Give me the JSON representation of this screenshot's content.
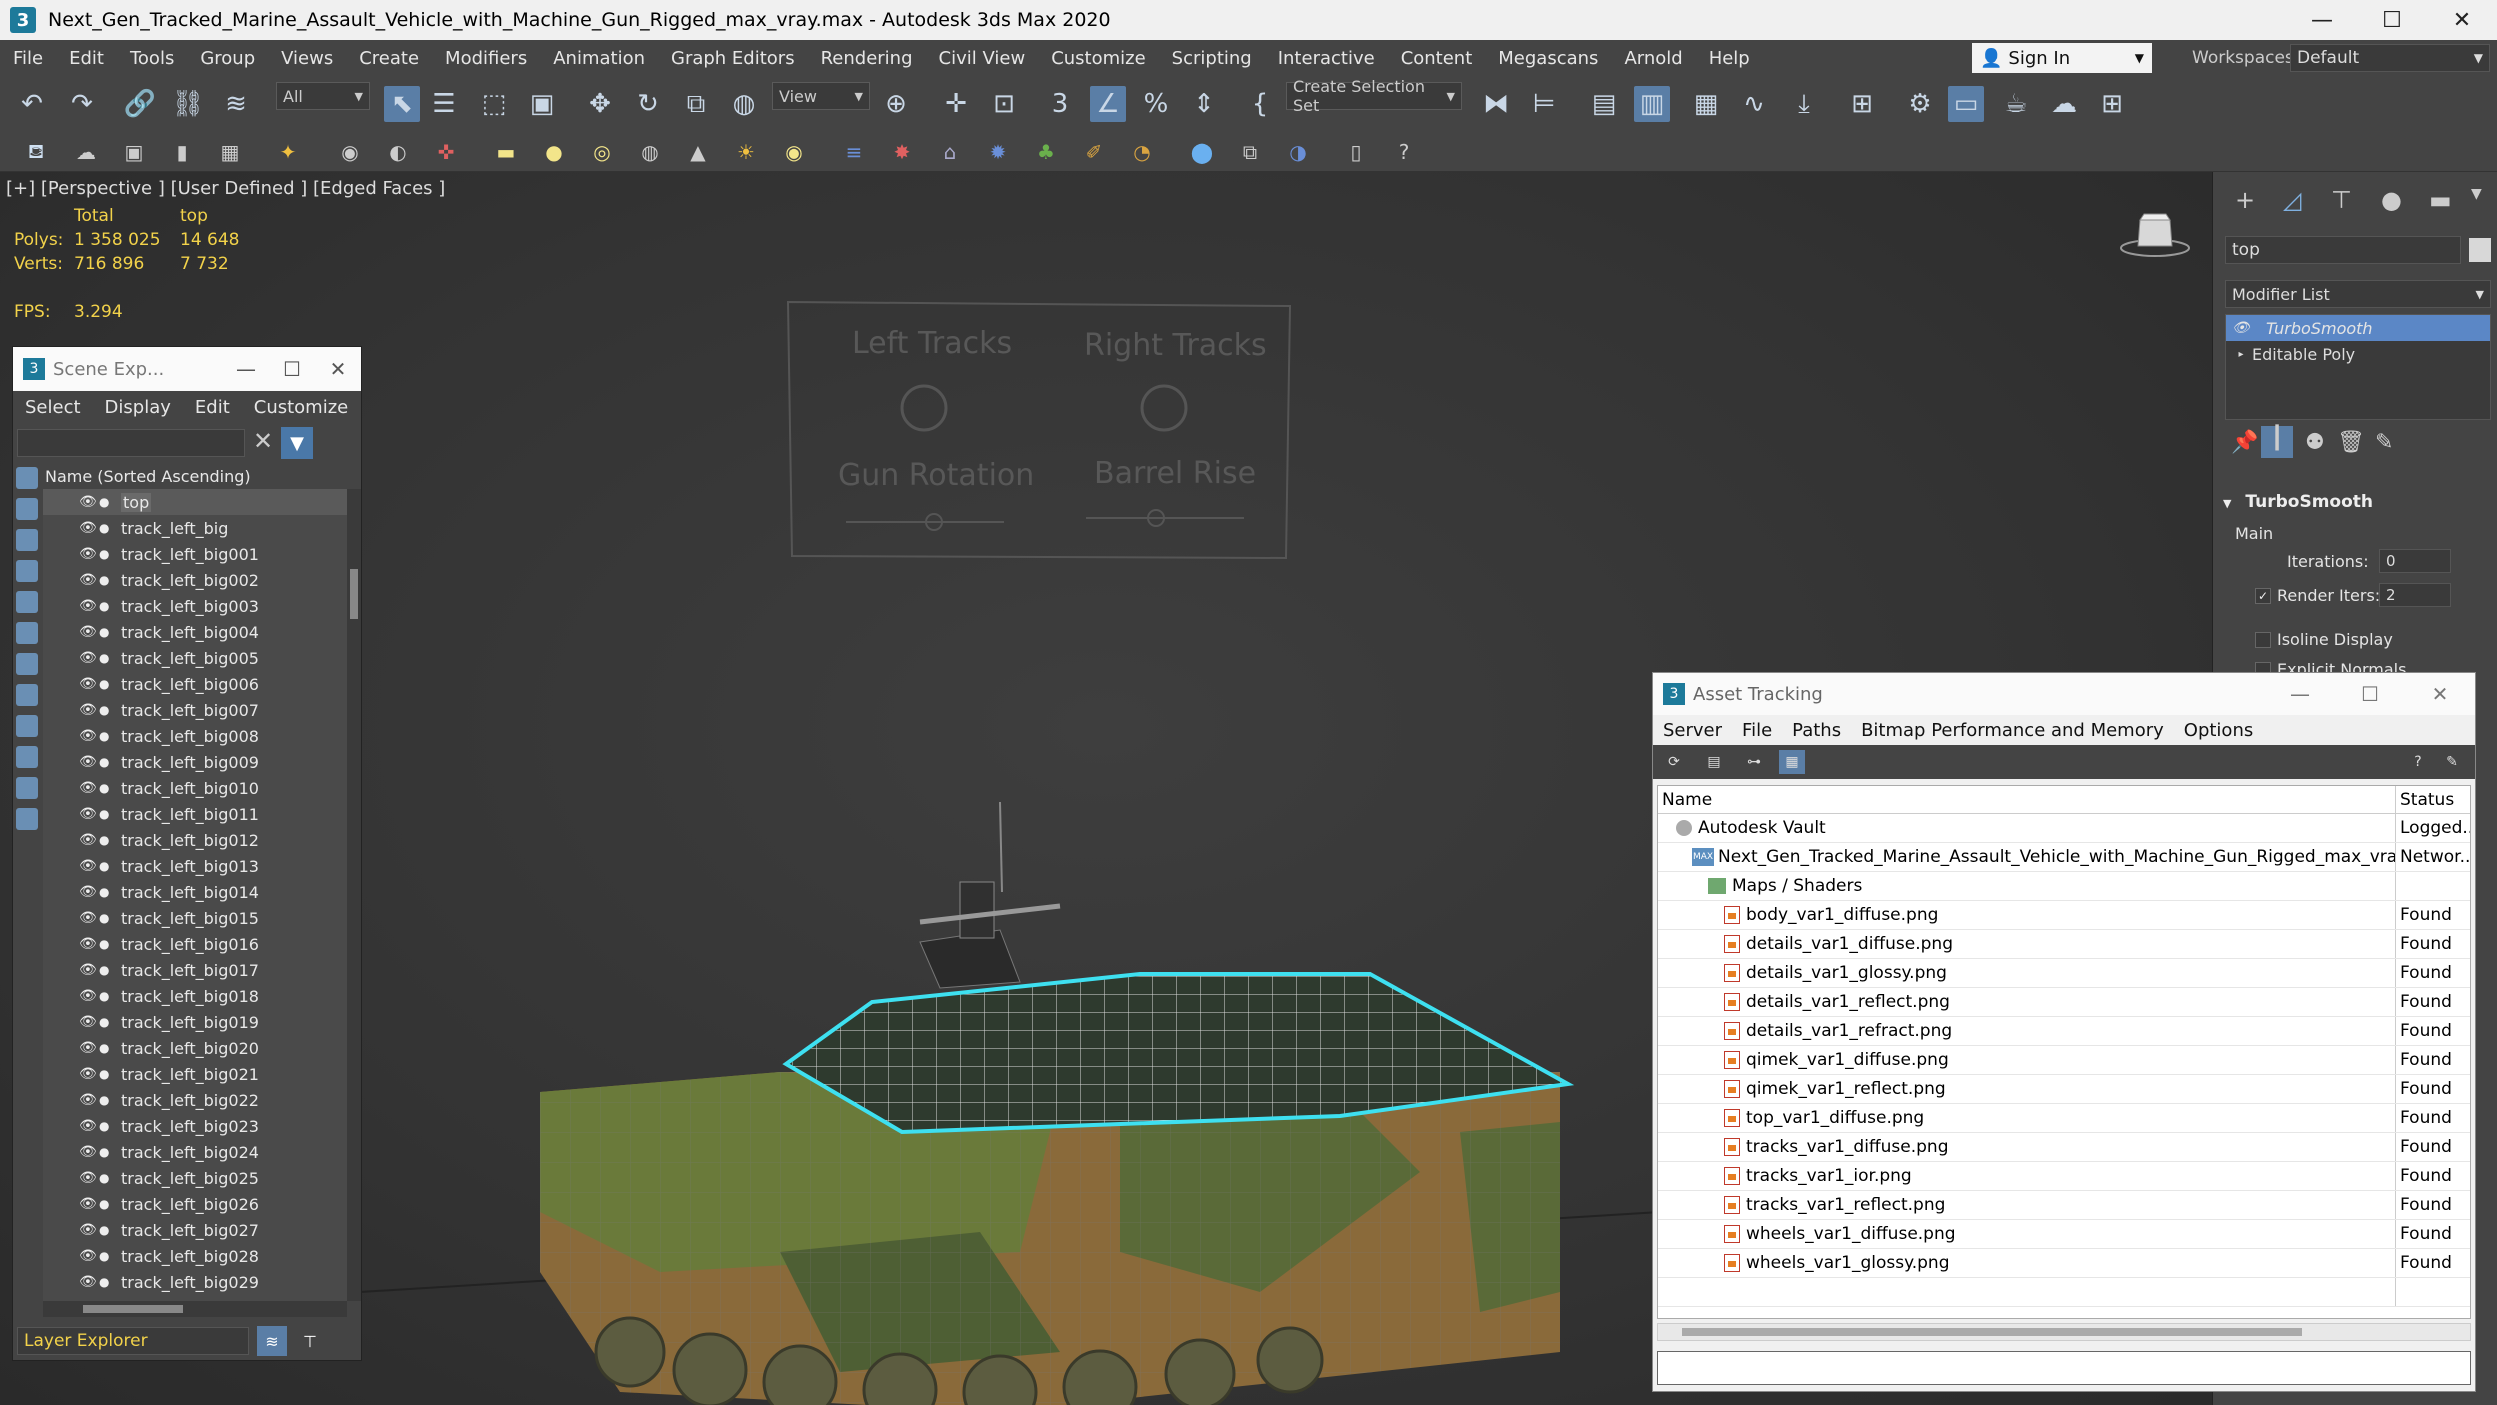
{
  "window": {
    "title": "Next_Gen_Tracked_Marine_Assault_Vehicle_with_Machine_Gun_Rigged_max_vray.max - Autodesk 3ds Max 2020",
    "app_icon": "3",
    "minimize": "—",
    "maximize": "☐",
    "close": "✕"
  },
  "menu": {
    "items": [
      "File",
      "Edit",
      "Tools",
      "Group",
      "Views",
      "Create",
      "Modifiers",
      "Animation",
      "Graph Editors",
      "Rendering",
      "Civil View",
      "Customize",
      "Scripting",
      "Interactive",
      "Content",
      "Megascans",
      "Arnold",
      "Help"
    ],
    "sign_in": "Sign In",
    "workspaces_label": "Workspaces:",
    "workspace": "Default"
  },
  "toolbar": {
    "filter": "All",
    "reference": "View",
    "selection_set": "Create Selection Set"
  },
  "viewport": {
    "label": "[+] [Perspective ] [User Defined ] [Edged Faces ]",
    "stats": {
      "total_header": "Total",
      "sel_header": "top",
      "polys_label": "Polys:",
      "polys_total": "1 358 025",
      "polys_sel": "14 648",
      "verts_label": "Verts:",
      "verts_total": "716 896",
      "verts_sel": "7 732",
      "fps_label": "FPS:",
      "fps": "3.294"
    },
    "rig_panel": {
      "left_tracks": "Left Tracks",
      "right_tracks": "Right Tracks",
      "gun_rotation": "Gun Rotation",
      "barrel_rise": "Barrel Rise"
    }
  },
  "scene_explorer": {
    "title": "Scene Exp...",
    "menu": [
      "Select",
      "Display",
      "Edit",
      "Customize"
    ],
    "column_header": "Name (Sorted Ascending)",
    "items": [
      "top",
      "track_left_big",
      "track_left_big001",
      "track_left_big002",
      "track_left_big003",
      "track_left_big004",
      "track_left_big005",
      "track_left_big006",
      "track_left_big007",
      "track_left_big008",
      "track_left_big009",
      "track_left_big010",
      "track_left_big011",
      "track_left_big012",
      "track_left_big013",
      "track_left_big014",
      "track_left_big015",
      "track_left_big016",
      "track_left_big017",
      "track_left_big018",
      "track_left_big019",
      "track_left_big020",
      "track_left_big021",
      "track_left_big022",
      "track_left_big023",
      "track_left_big024",
      "track_left_big025",
      "track_left_big026",
      "track_left_big027",
      "track_left_big028",
      "track_left_big029"
    ],
    "layer": "Layer Explorer"
  },
  "command_panel": {
    "object_name": "top",
    "modifier_list": "Modifier List",
    "stack": [
      "TurboSmooth",
      "Editable Poly"
    ],
    "rollout_title": "TurboSmooth",
    "section": "Main",
    "iterations_label": "Iterations:",
    "iterations": "0",
    "render_iters_label": "Render Iters:",
    "render_iters": "2",
    "isoline_label": "Isoline Display",
    "explicit_label": "Explicit Normals"
  },
  "asset_tracking": {
    "title": "Asset Tracking",
    "menu": [
      "Server",
      "File",
      "Paths",
      "Bitmap Performance and Memory",
      "Options"
    ],
    "col_name": "Name",
    "col_status": "Status",
    "vault": {
      "name": "Autodesk Vault",
      "status": "Logged..."
    },
    "file": {
      "name": "Next_Gen_Tracked_Marine_Assault_Vehicle_with_Machine_Gun_Rigged_max_vray.max",
      "status": "Networ..."
    },
    "folder": "Maps / Shaders",
    "maps": [
      {
        "name": "body_var1_diffuse.png",
        "status": "Found"
      },
      {
        "name": "details_var1_diffuse.png",
        "status": "Found"
      },
      {
        "name": "details_var1_glossy.png",
        "status": "Found"
      },
      {
        "name": "details_var1_reflect.png",
        "status": "Found"
      },
      {
        "name": "details_var1_refract.png",
        "status": "Found"
      },
      {
        "name": "qimek_var1_diffuse.png",
        "status": "Found"
      },
      {
        "name": "qimek_var1_reflect.png",
        "status": "Found"
      },
      {
        "name": "top_var1_diffuse.png",
        "status": "Found"
      },
      {
        "name": "tracks_var1_diffuse.png",
        "status": "Found"
      },
      {
        "name": "tracks_var1_ior.png",
        "status": "Found"
      },
      {
        "name": "tracks_var1_reflect.png",
        "status": "Found"
      },
      {
        "name": "wheels_var1_diffuse.png",
        "status": "Found"
      },
      {
        "name": "wheels_var1_glossy.png",
        "status": "Found"
      }
    ]
  }
}
